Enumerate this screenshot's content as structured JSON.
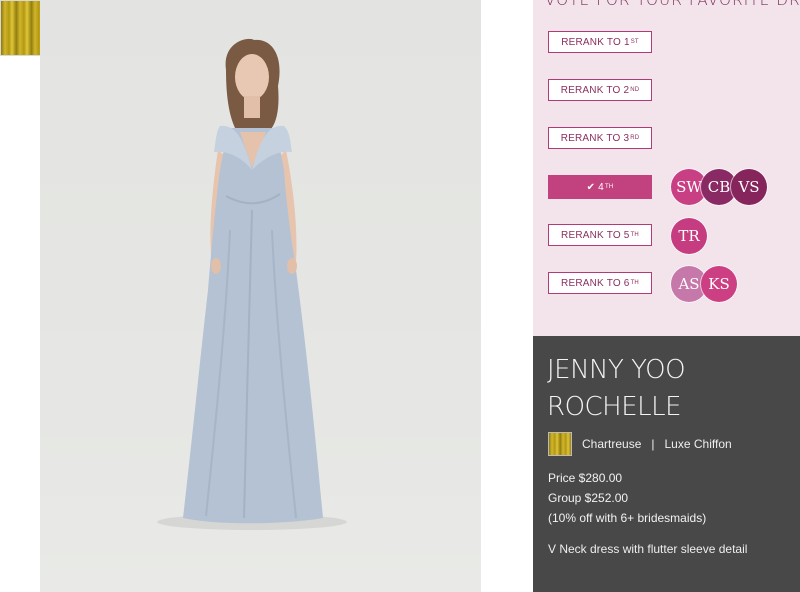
{
  "vote": {
    "title": "VOTE FOR YOUR FAVORITE DRE",
    "ranks": [
      {
        "prefix": "RERANK TO 1",
        "sup": "ST",
        "active": false,
        "voters": []
      },
      {
        "prefix": "RERANK TO 2",
        "sup": "ND",
        "active": false,
        "voters": []
      },
      {
        "prefix": "RERANK TO 3",
        "sup": "RD",
        "active": false,
        "voters": []
      },
      {
        "prefix": "✔ 4",
        "sup": "TH",
        "active": true,
        "voters": [
          {
            "initials": "SW",
            "color": "#c83f84"
          },
          {
            "initials": "CB",
            "color": "#8a2a64"
          },
          {
            "initials": "VS",
            "color": "#86245c"
          }
        ]
      },
      {
        "prefix": "RERANK TO 5",
        "sup": "TH",
        "active": false,
        "voters": [
          {
            "initials": "TR",
            "color": "#c53d80"
          }
        ]
      },
      {
        "prefix": "RERANK TO 6",
        "sup": "TH",
        "active": false,
        "voters": [
          {
            "initials": "AS",
            "color": "#c678aa"
          },
          {
            "initials": "KS",
            "color": "#cc3f82"
          }
        ]
      }
    ]
  },
  "product": {
    "brand_line1": "JENNY YOO",
    "brand_line2": "ROCHELLE",
    "color": "Chartreuse",
    "separator": "|",
    "fabric": "Luxe Chiffon",
    "price": "Price $280.00",
    "group": "Group $252.00",
    "discount": "(10% off with 6+ bridesmaids)",
    "description": "V Neck dress with flutter sleeve detail"
  }
}
